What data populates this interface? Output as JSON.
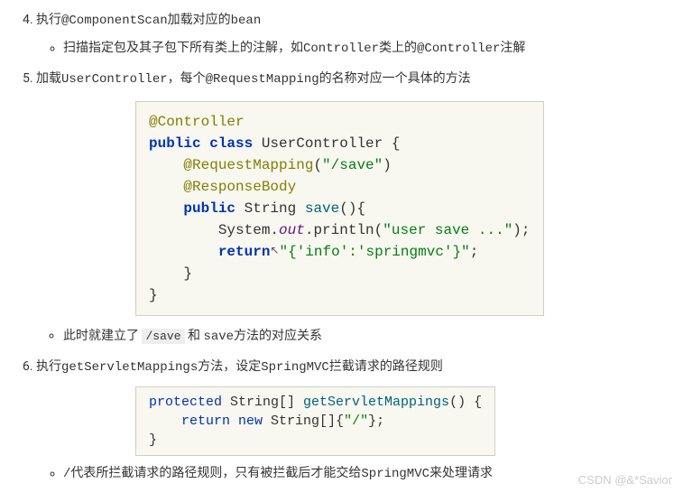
{
  "list": {
    "item4": {
      "text": "执行@ComponentScan加载对应的bean",
      "sub1": "扫描指定包及其子包下所有类上的注解，如Controller类上的@Controller注解"
    },
    "item5": {
      "text": "加载UserController，每个@RequestMapping的名称对应一个具体的方法",
      "sub1_prefix": "此时就建立了 ",
      "sub1_code": "/save",
      "sub1_mid": " 和 ",
      "sub1_code2": "save",
      "sub1_suffix": "方法的对应关系"
    },
    "item6": {
      "text": "执行getServletMappings方法，设定SpringMVC拦截请求的路径规则",
      "sub1": "/代表所拦截请求的路径规则，只有被拦截后才能交给SpringMVC来处理请求"
    }
  },
  "code1": {
    "l1": "@Controller",
    "l2_kw": "public class ",
    "l2_name": "UserController {",
    "l3_indent": "    ",
    "l3_ann": "@RequestMapping",
    "l3_paren_open": "(",
    "l3_str": "\"/save\"",
    "l3_paren_close": ")",
    "l4": "@ResponseBody",
    "l5_kw": "public ",
    "l5_type": "String ",
    "l5_method": "save",
    "l5_rest": "(){",
    "l6_indent": "        ",
    "l6_sys": "System.",
    "l6_out": "out",
    "l6_print": ".println(",
    "l6_str": "\"user save ...\"",
    "l6_end": ");",
    "l7_kw": "return",
    "l7_cursor": "↖",
    "l7_str": "\"{'info':'springmvc'}\"",
    "l7_end": ";",
    "l8": "    }",
    "l9": "}"
  },
  "code2": {
    "l1_kw": "protected ",
    "l1_type": "String[] ",
    "l1_method": "getServletMappings",
    "l1_rest": "() {",
    "l2_indent": "    ",
    "l2_kw": "return new ",
    "l2_type": "String[]",
    "l2_brace": "{",
    "l2_str": "\"/\"",
    "l2_end": "};",
    "l3": "}"
  },
  "watermark": "CSDN @&*Savior"
}
